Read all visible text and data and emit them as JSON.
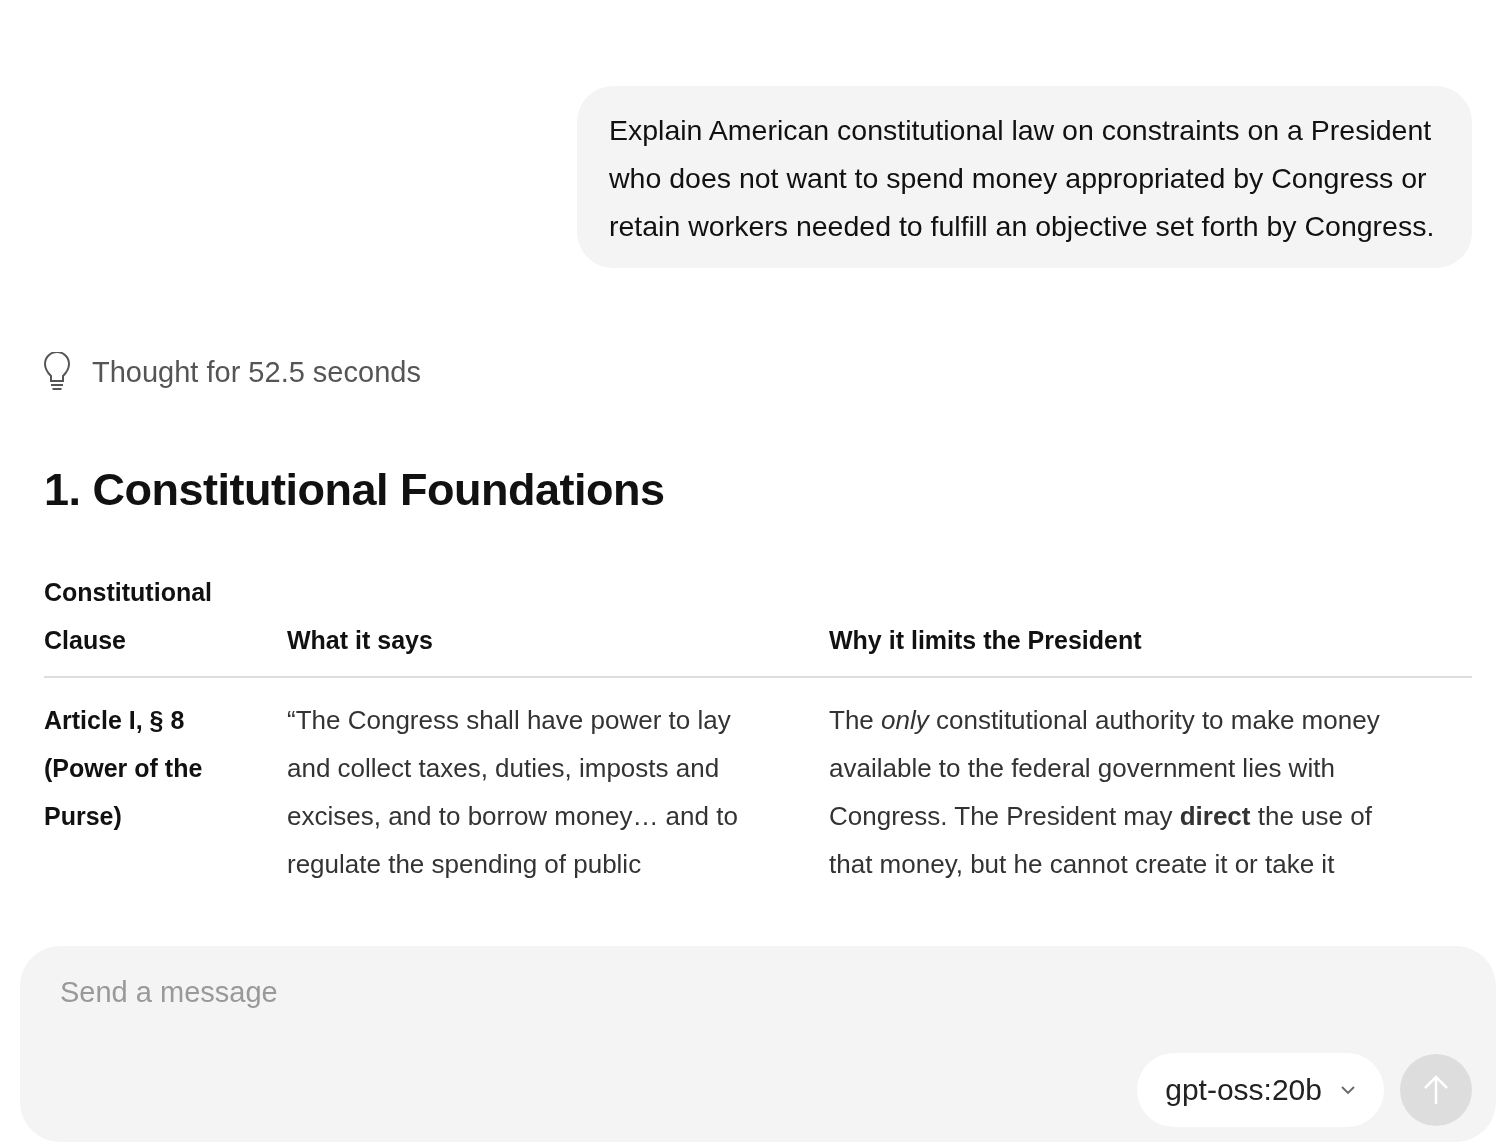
{
  "user_message": "Explain American constitutional law on constraints on a President who does not want to spend money appropriated by Congress or retain workers needed to fulfill an objective set forth by Congress.",
  "thought": {
    "label": "Thought for 52.5 seconds"
  },
  "heading": "1. Constitutional Foundations",
  "table": {
    "columns": [
      "Constitutional Clause",
      "What it says",
      "Why it limits the President"
    ],
    "rows": [
      {
        "cells": [
          [
            "Article I, § 8",
            "(Power of the",
            "Purse)"
          ],
          [
            "“The Congress shall have power to lay",
            "and collect taxes, duties, imposts and",
            "excises, and to borrow money… and to",
            "regulate the spending of public"
          ],
          [
            "The *only* constitutional authority to make money",
            "available to the federal government lies with",
            "Congress. The President may **direct** the use of",
            "that money, but he cannot create it or take it"
          ]
        ]
      }
    ]
  },
  "composer": {
    "placeholder": "Send a message",
    "model": "gpt-oss:20b"
  }
}
